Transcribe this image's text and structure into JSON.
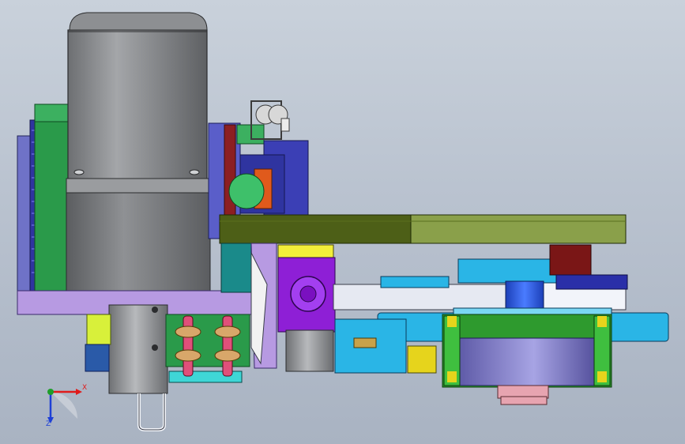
{
  "viewport": {
    "background_top": "#c9d1db",
    "background_bottom": "#a9b3c2"
  },
  "triad": {
    "x_label": "X",
    "y_label": "Y",
    "z_label": "Z",
    "x_color": "#e01b1b",
    "y_color": "#1f9e2a",
    "z_color": "#1d3fd6"
  },
  "palette": {
    "motor_body": "#8a8c8f",
    "gearbox": "#7c7e82",
    "plate_olive": "#4d5f17",
    "plate_light": "#8aa04a",
    "bracket_blue": "#3b3fb5",
    "bracket_purple": "#8e1fd6",
    "belt": "#e6e9f2",
    "cyan_plate": "#2ab5e6",
    "pulley_blue": "#2858e0",
    "bearing_purple": "#7a77c8",
    "bearing_green": "#2e9a2e",
    "chain_pink": "#e0507a",
    "mount_lavender": "#b79ae2",
    "dark_red": "#7a1616",
    "green_part": "#2a9a4a",
    "yellow_part": "#e6d41c"
  }
}
